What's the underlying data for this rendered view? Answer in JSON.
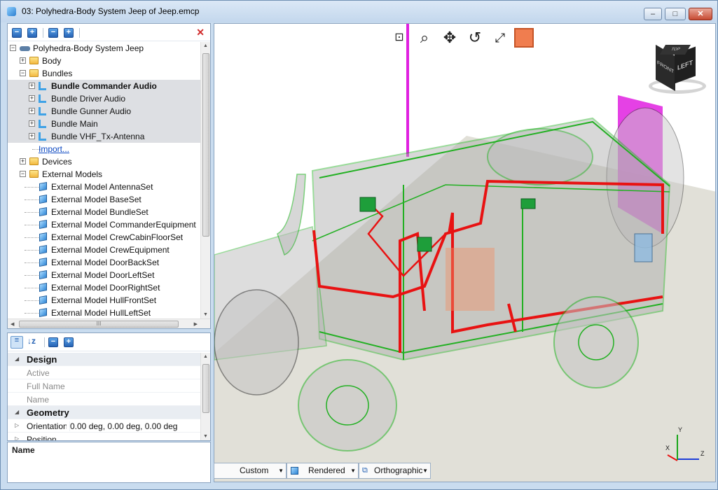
{
  "window": {
    "title": "03: Polyhedra-Body System Jeep of Jeep.emcp",
    "buttons": {
      "minimize": "–",
      "maximize": "□",
      "close": "✕"
    }
  },
  "tree_toolbar": {
    "close": "✕"
  },
  "tree": {
    "root": "Polyhedra-Body System Jeep",
    "items": [
      {
        "label": "Body"
      },
      {
        "label": "Bundles"
      },
      {
        "label": "Bundle Commander Audio"
      },
      {
        "label": "Bundle Driver Audio"
      },
      {
        "label": "Bundle Gunner Audio"
      },
      {
        "label": "Bundle Main"
      },
      {
        "label": "Bundle VHF_Tx-Antenna"
      },
      {
        "label": "Import..."
      },
      {
        "label": "Devices"
      },
      {
        "label": "External Models"
      },
      {
        "label": "External Model AntennaSet"
      },
      {
        "label": "External Model BaseSet"
      },
      {
        "label": "External Model BundleSet"
      },
      {
        "label": "External Model CommanderEquipment"
      },
      {
        "label": "External Model CrewCabinFloorSet"
      },
      {
        "label": "External Model CrewEquipment"
      },
      {
        "label": "External Model DoorBackSet"
      },
      {
        "label": "External Model DoorLeftSet"
      },
      {
        "label": "External Model DoorRightSet"
      },
      {
        "label": "External Model HullFrontSet"
      },
      {
        "label": "External Model HullLeftSet"
      }
    ],
    "hscroll_grip": "III"
  },
  "properties": {
    "rows": [
      {
        "key": "Design"
      },
      {
        "key": "Active",
        "value": ""
      },
      {
        "key": "Full Name",
        "value": ""
      },
      {
        "key": "Name",
        "value": ""
      },
      {
        "key": "Geometry"
      },
      {
        "key": "Orientation",
        "value": "0.00 deg, 0.00 deg, 0.00 deg"
      },
      {
        "key": "Position",
        "value": ""
      }
    ],
    "description_title": "Name"
  },
  "viewport": {
    "view_cube_label": "LEFT",
    "view_cube_top": "TOP",
    "view_cube_front": "FRONT",
    "axes": {
      "x": "X",
      "y": "Y",
      "z": "Z"
    },
    "icons": [
      "zoom-window-icon",
      "zoom-icon",
      "pan-icon",
      "rotate-icon",
      "fit-icon",
      "select-box-icon"
    ]
  },
  "bottom_bar": {
    "view": "Custom",
    "render_mode": "Rendered",
    "projection": "Orthographic"
  },
  "colors": {
    "wire_green": "#22b022",
    "bundle_red": "#e81212",
    "antenna_magenta": "#e020e0",
    "floor": "#e1e0d8",
    "active_tool": "#f07d4f"
  }
}
